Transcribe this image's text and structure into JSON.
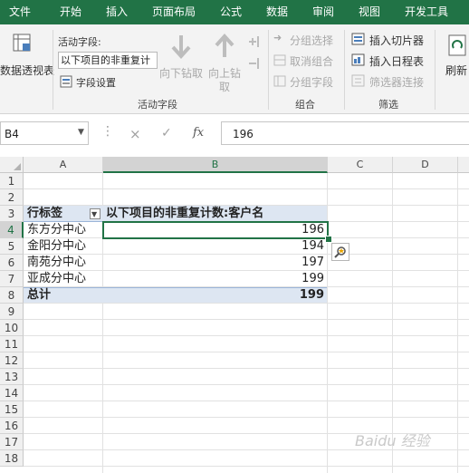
{
  "menu": [
    "文件",
    "开始",
    "插入",
    "页面布局",
    "公式",
    "数据",
    "审阅",
    "视图",
    "开发工具"
  ],
  "ribbon": {
    "pivot_btn": "数据透视表",
    "active_field_label": "活动字段:",
    "active_field_value": "以下项目的非重复计",
    "field_settings": "字段设置",
    "drill_down": "向下钻取",
    "drill_up": "向上钻",
    "drill_up2": "取",
    "group_selection": "分组选择",
    "ungroup": "取消组合",
    "group_field": "分组字段",
    "insert_slicer": "插入切片器",
    "insert_timeline": "插入日程表",
    "filter_connections": "筛选器连接",
    "refresh": "刷新",
    "group_active_field": "活动字段",
    "group_group": "组合",
    "group_filter": "筛选"
  },
  "formula_bar": {
    "name_box": "B4",
    "cancel": "×",
    "enter": "✓",
    "fx": "fx",
    "formula": "196"
  },
  "columns": [
    "A",
    "B",
    "C",
    "D"
  ],
  "rows": [
    "1",
    "2",
    "3",
    "4",
    "5",
    "6",
    "7",
    "8",
    "9",
    "10",
    "11",
    "12",
    "13",
    "14",
    "15",
    "16",
    "17",
    "18"
  ],
  "pivot": {
    "row_label": "行标签",
    "value_header": "以下项目的非重复计数:客户名",
    "items": [
      {
        "name": "东方分中心",
        "count": "196"
      },
      {
        "name": "金阳分中心",
        "count": "194"
      },
      {
        "name": "南苑分中心",
        "count": "197"
      },
      {
        "name": "亚成分中心",
        "count": "199"
      }
    ],
    "total_label": "总计",
    "total_value": "199"
  },
  "watermark": "Baidu 经验",
  "colors": {
    "excel_green": "#217346",
    "pivot_header": "#dde6f2",
    "selection": "#217346"
  }
}
